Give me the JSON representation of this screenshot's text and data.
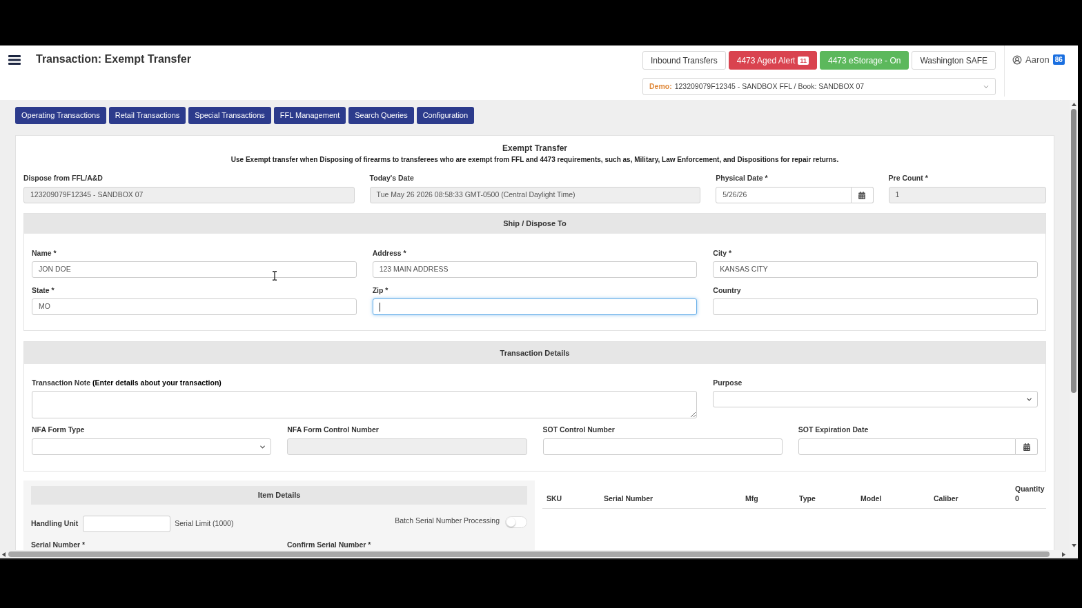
{
  "header": {
    "title": "Transaction: Exempt Transfer",
    "buttons": [
      {
        "label": "Inbound Transfers",
        "kind": "default"
      },
      {
        "label": "4473 Aged Alert",
        "kind": "danger",
        "badge": "11"
      },
      {
        "label": "4473 eStorage - On",
        "kind": "success"
      },
      {
        "label": "Washington SAFE",
        "kind": "default"
      }
    ],
    "book_select": {
      "prefix": "Demo:",
      "value": "123209079F12345 - SANDBOX FFL / Book: SANDBOX 07"
    },
    "user": {
      "name": "Aaron",
      "badge": "86"
    }
  },
  "nav_tabs": [
    "Operating Transactions",
    "Retail Transactions",
    "Special Transactions",
    "FFL Management",
    "Search Queries",
    "Configuration"
  ],
  "form": {
    "title": "Exempt Transfer",
    "description": "Use Exempt transfer when Disposing of firearms to transferees who are exempt from FFL and 4473 requirements, such as, Military, Law Enforcement, and Dispositions for repair returns.",
    "fields": [
      {
        "label": "Dispose from FFL/A&D",
        "value": "123209079F12345 - SANDBOX 07",
        "kind": "text",
        "disabled": true
      },
      {
        "label": "Today's Date",
        "value": "Tue May 26 2026 08:58:33 GMT-0500 (Central Daylight Time)",
        "kind": "text",
        "disabled": true
      },
      {
        "label": "Physical Date *",
        "value": "5/26/26",
        "kind": "date",
        "disabled": false
      },
      {
        "label": "Pre Count *",
        "value": "1",
        "kind": "text",
        "disabled": true
      }
    ]
  },
  "ship_to": {
    "title": "Ship / Dispose To",
    "fields": [
      {
        "label": "Name *",
        "value": "JON DOE",
        "focused": false
      },
      {
        "label": "Address *",
        "value": "123 MAIN ADDRESS",
        "focused": false
      },
      {
        "label": "City *",
        "value": "KANSAS CITY",
        "focused": false
      },
      {
        "label": "State *",
        "value": "MO",
        "focused": false
      },
      {
        "label": "Zip *",
        "focused": true
      },
      {
        "label": "Country",
        "focused": false
      }
    ]
  },
  "transaction_details": {
    "title": "Transaction Details",
    "fields": [
      {
        "label": "Transaction Note **(Enter details about your transaction)**",
        "kind": "textarea",
        "disabled": false
      },
      {
        "label": "Purpose",
        "kind": "select",
        "disabled": false
      },
      {
        "label": "NFA Form Type",
        "kind": "select",
        "disabled": false
      },
      {
        "label": "NFA Form Control Number",
        "kind": "text",
        "disabled": true
      },
      {
        "label": "SOT Control Number",
        "kind": "text",
        "disabled": false
      },
      {
        "label": "SOT Expiration Date",
        "kind": "date",
        "disabled": false
      }
    ]
  },
  "item_details": {
    "title": "Item Details",
    "handling_unit": {
      "label": "Handling Unit"
    },
    "serial_limit": "Serial Limit (1000)",
    "batch_processing": {
      "label": "Batch Serial Number Processing",
      "on": false
    },
    "serial_fields": [
      {
        "label": "Serial Number *"
      },
      {
        "label": "Confirm Serial Number *"
      }
    ]
  },
  "items_table": {
    "columns": [
      {
        "label": "SKU"
      },
      {
        "label": "Serial Number"
      },
      {
        "label": "Mfg"
      },
      {
        "label": "Type"
      },
      {
        "label": "Model"
      },
      {
        "label": "Caliber"
      },
      {
        "label": "Quantity",
        "total": "0"
      }
    ]
  }
}
